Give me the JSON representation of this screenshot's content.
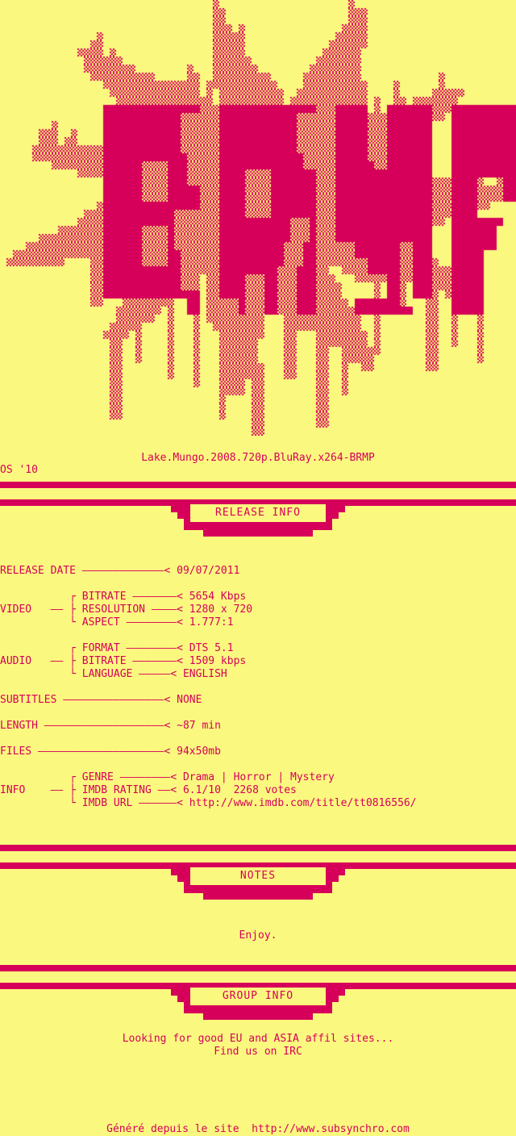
{
  "palette": {
    "background": "#fbf87f",
    "ink": "#d6005a"
  },
  "logo": {
    "art_text": "BRMP",
    "description": "ascii-splatter-logo"
  },
  "header": {
    "release_title": "Lake.Mungo.2008.720p.BluRay.x264-BRMP",
    "artist_signature": "OS '10"
  },
  "sections": [
    {
      "label": "RELEASE INFO"
    },
    {
      "label": "NOTES"
    },
    {
      "label": "GROUP INFO"
    }
  ],
  "release_info": {
    "rows": [
      {
        "kind": "single",
        "label": "RELEASE DATE",
        "leader": " —————————————< ",
        "value": "09/07/2011"
      },
      {
        "kind": "spacer"
      },
      {
        "kind": "group-top",
        "group": "",
        "branch": "┌",
        "label": "BITRATE",
        "leader": " ———————< ",
        "value": "5654 Kbps"
      },
      {
        "kind": "group-mid",
        "group": "VIDEO",
        "branch": "├",
        "label": "RESOLUTION",
        "leader": " ————< ",
        "value": "1280 x 720"
      },
      {
        "kind": "group-end",
        "group": "",
        "branch": "└",
        "label": "ASPECT",
        "leader": " ————————< ",
        "value": "1.777:1"
      },
      {
        "kind": "spacer"
      },
      {
        "kind": "group-top",
        "group": "",
        "branch": "┌",
        "label": "FORMAT",
        "leader": " ————————< ",
        "value": "DTS 5.1"
      },
      {
        "kind": "group-mid",
        "group": "AUDIO",
        "branch": "├",
        "label": "BITRATE",
        "leader": " ———————< ",
        "value": "1509 kbps"
      },
      {
        "kind": "group-end",
        "group": "",
        "branch": "└",
        "label": "LANGUAGE",
        "leader": " —————< ",
        "value": "ENGLISH"
      },
      {
        "kind": "spacer"
      },
      {
        "kind": "single",
        "label": "SUBTITLES",
        "leader": " ————————————————< ",
        "value": "NONE"
      },
      {
        "kind": "spacer"
      },
      {
        "kind": "single",
        "label": "LENGTH",
        "leader": " ———————————————————< ",
        "value": "~87 min"
      },
      {
        "kind": "spacer"
      },
      {
        "kind": "single",
        "label": "FILES",
        "leader": " ————————————————————< ",
        "value": "94x50mb"
      },
      {
        "kind": "spacer"
      },
      {
        "kind": "group-top",
        "group": "",
        "branch": "┌",
        "label": "GENRE",
        "leader": " ————————< ",
        "value": "Drama | Horror | Mystery"
      },
      {
        "kind": "group-mid",
        "group": "INFO",
        "branch": "├",
        "label": "IMDB RATING",
        "leader": " ——< ",
        "value": "6.1/10  2268 votes"
      },
      {
        "kind": "group-end",
        "group": "",
        "branch": "└",
        "label": "IMDB URL",
        "leader": " ——————< ",
        "value": "http://www.imdb.com/title/tt0816556/"
      }
    ]
  },
  "notes": {
    "text": "Enjoy."
  },
  "group_info": {
    "line1": "Looking for good EU and ASIA affil sites...",
    "line2": "Find us on IRC"
  },
  "footer": {
    "generated_by": "Généré depuis le site  http://www.subsynchro.com"
  }
}
